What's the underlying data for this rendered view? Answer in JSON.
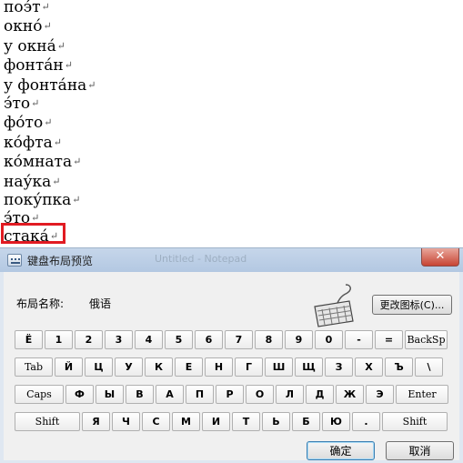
{
  "document": {
    "lines": [
      "поэ́т",
      "окно́",
      "у окна́",
      "фонта́н",
      "у фонта́на",
      "э́то",
      "фо́то",
      "ко́фта",
      "ко́мната",
      "нау́ка",
      "поку́пка",
      "э́то",
      "стака́"
    ],
    "paragraph_mark": "↵"
  },
  "dialog": {
    "title": "键盘布局预览",
    "background_title": "Untitled - Notepad",
    "close_label": "✕",
    "layout_name_label": "布局名称:",
    "layout_name_value": "俄语",
    "change_icon_label": "更改图标(C)...",
    "ok_label": "确定",
    "cancel_label": "取消",
    "keyboard_rows": [
      [
        "Ё",
        "1",
        "2",
        "3",
        "4",
        "5",
        "6",
        "7",
        "8",
        "9",
        "0",
        "-",
        "=",
        "BackSp"
      ],
      [
        "Tab",
        "Й",
        "Ц",
        "У",
        "К",
        "Е",
        "Н",
        "Г",
        "Ш",
        "Щ",
        "З",
        "Х",
        "Ъ",
        "\\"
      ],
      [
        "Caps",
        "Ф",
        "Ы",
        "В",
        "А",
        "П",
        "Р",
        "О",
        "Л",
        "Д",
        "Ж",
        "Э",
        "Enter"
      ],
      [
        "Shift",
        "Я",
        "Ч",
        "С",
        "М",
        "И",
        "Т",
        "Ь",
        "Б",
        "Ю",
        ".",
        "Shift"
      ]
    ]
  },
  "colors": {
    "highlight": "#e11b22",
    "dialog_border": "#dfe7f1",
    "close_button": "#c74433"
  }
}
